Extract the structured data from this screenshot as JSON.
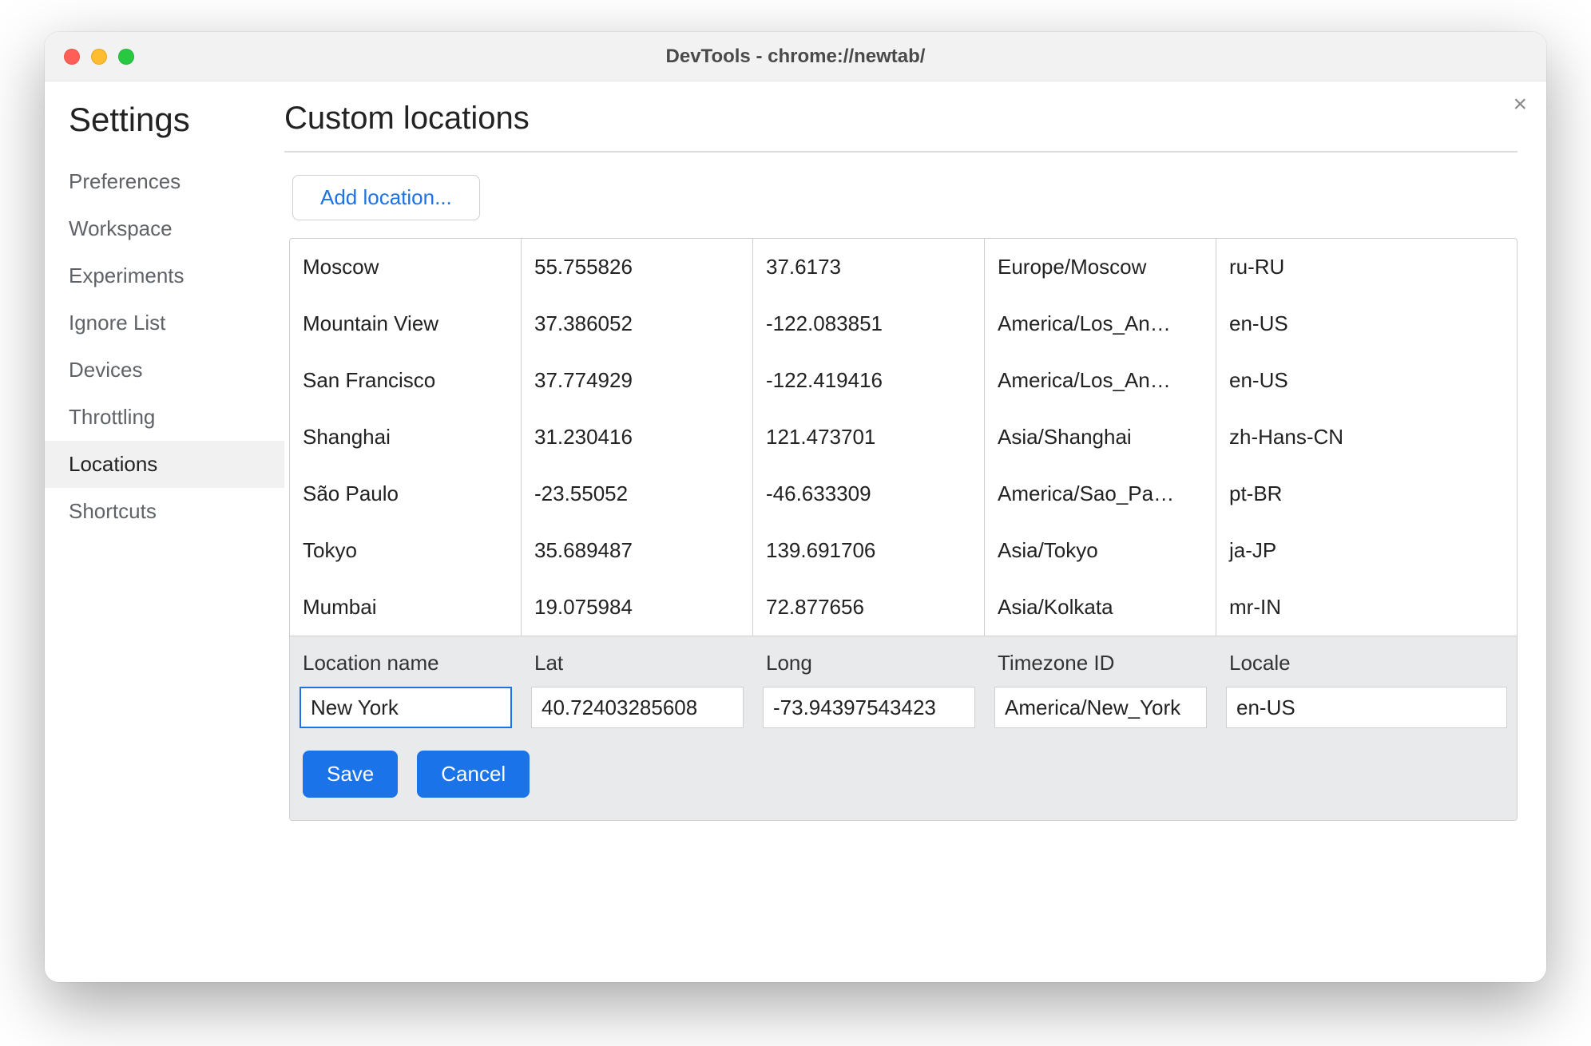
{
  "window": {
    "title": "DevTools - chrome://newtab/"
  },
  "sidebar": {
    "heading": "Settings",
    "items": [
      "Preferences",
      "Workspace",
      "Experiments",
      "Ignore List",
      "Devices",
      "Throttling",
      "Locations",
      "Shortcuts"
    ],
    "active_index": 6
  },
  "main": {
    "heading": "Custom locations",
    "add_button_label": "Add location...",
    "close_glyph": "×",
    "columns": [
      "name",
      "lat",
      "long",
      "tz",
      "locale"
    ],
    "rows": [
      {
        "name": "Moscow",
        "lat": "55.755826",
        "long": "37.6173",
        "tz": "Europe/Moscow",
        "locale": "ru-RU"
      },
      {
        "name": "Mountain View",
        "lat": "37.386052",
        "long": "-122.083851",
        "tz": "America/Los_An…",
        "locale": "en-US"
      },
      {
        "name": "San Francisco",
        "lat": "37.774929",
        "long": "-122.419416",
        "tz": "America/Los_An…",
        "locale": "en-US"
      },
      {
        "name": "Shanghai",
        "lat": "31.230416",
        "long": "121.473701",
        "tz": "Asia/Shanghai",
        "locale": "zh-Hans-CN"
      },
      {
        "name": "São Paulo",
        "lat": "-23.55052",
        "long": "-46.633309",
        "tz": "America/Sao_Pa…",
        "locale": "pt-BR"
      },
      {
        "name": "Tokyo",
        "lat": "35.689487",
        "long": "139.691706",
        "tz": "Asia/Tokyo",
        "locale": "ja-JP"
      },
      {
        "name": "Mumbai",
        "lat": "19.075984",
        "long": "72.877656",
        "tz": "Asia/Kolkata",
        "locale": "mr-IN"
      }
    ],
    "editor": {
      "labels": {
        "name": "Location name",
        "lat": "Lat",
        "long": "Long",
        "tz": "Timezone ID",
        "locale": "Locale"
      },
      "values": {
        "name": "New York",
        "lat": "40.72403285608",
        "long": "-73.94397543423",
        "tz": "America/New_York",
        "locale": "en-US"
      },
      "save_label": "Save",
      "cancel_label": "Cancel"
    }
  }
}
